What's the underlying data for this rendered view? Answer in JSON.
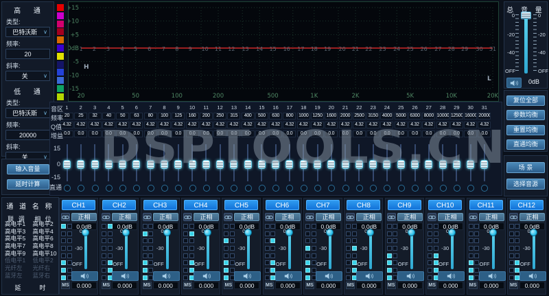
{
  "watermark": "DSPTOOLS.CN",
  "highpass": {
    "title": "高 通",
    "type_label": "类型:",
    "type_value": "巴特沃斯",
    "freq_label": "频率:",
    "freq_value": "20",
    "slope_label": "斜率:",
    "slope_value": "关"
  },
  "lowpass": {
    "title": "低 通",
    "type_label": "类型:",
    "type_value": "巴特沃斯",
    "freq_label": "频率:",
    "freq_value": "20000",
    "slope_label": "斜率:",
    "slope_value": "关"
  },
  "left_buttons": {
    "input_volume": "输入音量",
    "delay_calc": "延时计算"
  },
  "channel_names": {
    "title": "通 道 名 称",
    "col_headers": [
      "联 调",
      "相 位"
    ],
    "rows": [
      {
        "left": "高电平1",
        "right": "高电平2",
        "enabled": true
      },
      {
        "left": "高电平3",
        "right": "高电平4",
        "enabled": true
      },
      {
        "left": "高电平5",
        "right": "高电平6",
        "enabled": true
      },
      {
        "left": "高电平7",
        "right": "高电平8",
        "enabled": true
      },
      {
        "left": "高电平9",
        "right": "高电平10",
        "enabled": true
      },
      {
        "left": "低电平1",
        "right": "低电平2",
        "enabled": false
      },
      {
        "left": "光纤左",
        "right": "光纤右",
        "enabled": false
      },
      {
        "left": "蓝牙左",
        "right": "蓝牙右",
        "enabled": false
      }
    ],
    "delay_label": "延　　　时"
  },
  "band_colors": [
    "#e60000",
    "#cc00cc",
    "#d4006e",
    "#a3001f",
    "#d86a00",
    "#3a00d0",
    "#e0e000",
    "#141466",
    "#2342d8",
    "#3b6ad8",
    "#0fa263",
    "#b4d800"
  ],
  "chart_data": {
    "type": "line",
    "title": "31-band EQ frequency response",
    "x_labels": [
      "20",
      "50",
      "100",
      "200",
      "500",
      "1K",
      "2K",
      "5K",
      "10K",
      "20K"
    ],
    "x_label_freqs": [
      20,
      50,
      100,
      200,
      500,
      1000,
      2000,
      5000,
      10000,
      20000
    ],
    "y_labels": [
      "+15",
      "+10",
      "+5",
      "0dB",
      "-5",
      "-10",
      "-15"
    ],
    "y_label_values": [
      15,
      10,
      5,
      0,
      -5,
      -10,
      -15
    ],
    "ylim": [
      -15,
      15
    ],
    "xlog_range": [
      20,
      20000
    ],
    "grid_freqs": [
      30,
      40,
      50,
      70,
      100,
      150,
      200,
      300,
      400,
      500,
      700,
      1000,
      1500,
      2000,
      3000,
      4000,
      5000,
      7000,
      10000,
      15000,
      20000
    ],
    "h_marker": "H",
    "l_marker": "L",
    "band_numbers": [
      1,
      2,
      3,
      4,
      5,
      6,
      7,
      8,
      9,
      10,
      11,
      12,
      13,
      14,
      15,
      16,
      17,
      18,
      19,
      20,
      21,
      22,
      23,
      24,
      25,
      26,
      27,
      28,
      29,
      30,
      31
    ],
    "band_freqs": [
      20,
      25,
      31.5,
      40,
      50,
      63,
      80,
      100,
      125,
      160,
      200,
      250,
      315,
      400,
      500,
      630,
      800,
      1000,
      1250,
      1600,
      2000,
      2500,
      3150,
      4000,
      5000,
      6300,
      8000,
      10000,
      12500,
      16000,
      20000
    ],
    "curve_gain_db": 0
  },
  "eq_table": {
    "row_labels": [
      "音区",
      "频率",
      "Q值",
      "增益"
    ],
    "freqs": [
      "20",
      "25",
      "32",
      "40",
      "50",
      "63",
      "80",
      "100",
      "125",
      "160",
      "200",
      "250",
      "315",
      "400",
      "500",
      "630",
      "800",
      "1000",
      "1250",
      "1600",
      "2000",
      "2500",
      "3150",
      "4000",
      "5000",
      "6300",
      "8000",
      "10000",
      "12500",
      "16000",
      "20000"
    ],
    "q_value": "4.32",
    "gain_value": "0.0"
  },
  "eq_sliders": {
    "scale_top": "15",
    "scale_mid": "0",
    "scale_bottom": "-15",
    "bypass_label": "直通"
  },
  "master": {
    "title": "总 音 量",
    "scale": [
      "0",
      "-20",
      "-40",
      "OFF"
    ],
    "volume_value": "0dB",
    "eq_buttons": [
      "复位全部",
      "参数均衡",
      "重置均衡",
      "直通均衡"
    ],
    "scene_buttons": [
      "场 景",
      "选择音源"
    ]
  },
  "channels": {
    "phase_label": "正相",
    "gain_value": "0.0dB",
    "fader_scale": [
      "0",
      "-30",
      "OFF"
    ],
    "ms_label": "MS",
    "delay_value": "0.000",
    "list": [
      {
        "name": "CH1",
        "checks": [
          [
            1,
            0
          ],
          [
            0,
            0
          ],
          [
            0,
            0
          ],
          [
            0,
            0
          ],
          [
            0,
            0
          ],
          [
            1,
            0
          ],
          [
            1,
            0
          ],
          [
            1,
            0
          ]
        ]
      },
      {
        "name": "CH2",
        "checks": [
          [
            0,
            1
          ],
          [
            0,
            0
          ],
          [
            0,
            0
          ],
          [
            0,
            0
          ],
          [
            0,
            0
          ],
          [
            0,
            1
          ],
          [
            0,
            1
          ],
          [
            0,
            1
          ]
        ]
      },
      {
        "name": "CH3",
        "checks": [
          [
            0,
            0
          ],
          [
            1,
            0
          ],
          [
            0,
            0
          ],
          [
            0,
            0
          ],
          [
            0,
            0
          ],
          [
            1,
            0
          ],
          [
            1,
            0
          ],
          [
            1,
            0
          ]
        ]
      },
      {
        "name": "CH4",
        "checks": [
          [
            0,
            0
          ],
          [
            0,
            1
          ],
          [
            0,
            0
          ],
          [
            0,
            0
          ],
          [
            0,
            0
          ],
          [
            0,
            1
          ],
          [
            0,
            1
          ],
          [
            0,
            1
          ]
        ]
      },
      {
        "name": "CH5",
        "checks": [
          [
            0,
            0
          ],
          [
            0,
            0
          ],
          [
            1,
            0
          ],
          [
            0,
            0
          ],
          [
            0,
            0
          ],
          [
            1,
            0
          ],
          [
            1,
            0
          ],
          [
            1,
            0
          ]
        ]
      },
      {
        "name": "CH6",
        "checks": [
          [
            0,
            0
          ],
          [
            0,
            0
          ],
          [
            0,
            1
          ],
          [
            0,
            0
          ],
          [
            0,
            0
          ],
          [
            0,
            1
          ],
          [
            0,
            1
          ],
          [
            0,
            1
          ]
        ]
      },
      {
        "name": "CH7",
        "checks": [
          [
            0,
            0
          ],
          [
            0,
            0
          ],
          [
            0,
            0
          ],
          [
            1,
            0
          ],
          [
            0,
            0
          ],
          [
            1,
            0
          ],
          [
            1,
            0
          ],
          [
            1,
            0
          ]
        ]
      },
      {
        "name": "CH8",
        "checks": [
          [
            0,
            0
          ],
          [
            0,
            0
          ],
          [
            0,
            0
          ],
          [
            0,
            1
          ],
          [
            0,
            0
          ],
          [
            0,
            1
          ],
          [
            0,
            1
          ],
          [
            0,
            1
          ]
        ]
      },
      {
        "name": "CH9",
        "checks": [
          [
            0,
            0
          ],
          [
            0,
            0
          ],
          [
            0,
            0
          ],
          [
            0,
            0
          ],
          [
            1,
            0
          ],
          [
            1,
            0
          ],
          [
            1,
            0
          ],
          [
            1,
            0
          ]
        ]
      },
      {
        "name": "CH10",
        "checks": [
          [
            0,
            0
          ],
          [
            0,
            0
          ],
          [
            0,
            0
          ],
          [
            0,
            0
          ],
          [
            0,
            1
          ],
          [
            0,
            1
          ],
          [
            0,
            1
          ],
          [
            0,
            1
          ]
        ]
      },
      {
        "name": "CH11",
        "checks": [
          [
            0,
            0
          ],
          [
            0,
            0
          ],
          [
            0,
            0
          ],
          [
            0,
            0
          ],
          [
            0,
            0
          ],
          [
            1,
            0
          ],
          [
            1,
            0
          ],
          [
            1,
            0
          ]
        ]
      },
      {
        "name": "CH12",
        "checks": [
          [
            0,
            0
          ],
          [
            0,
            0
          ],
          [
            0,
            0
          ],
          [
            0,
            0
          ],
          [
            0,
            0
          ],
          [
            0,
            1
          ],
          [
            0,
            1
          ],
          [
            0,
            1
          ]
        ]
      }
    ]
  }
}
